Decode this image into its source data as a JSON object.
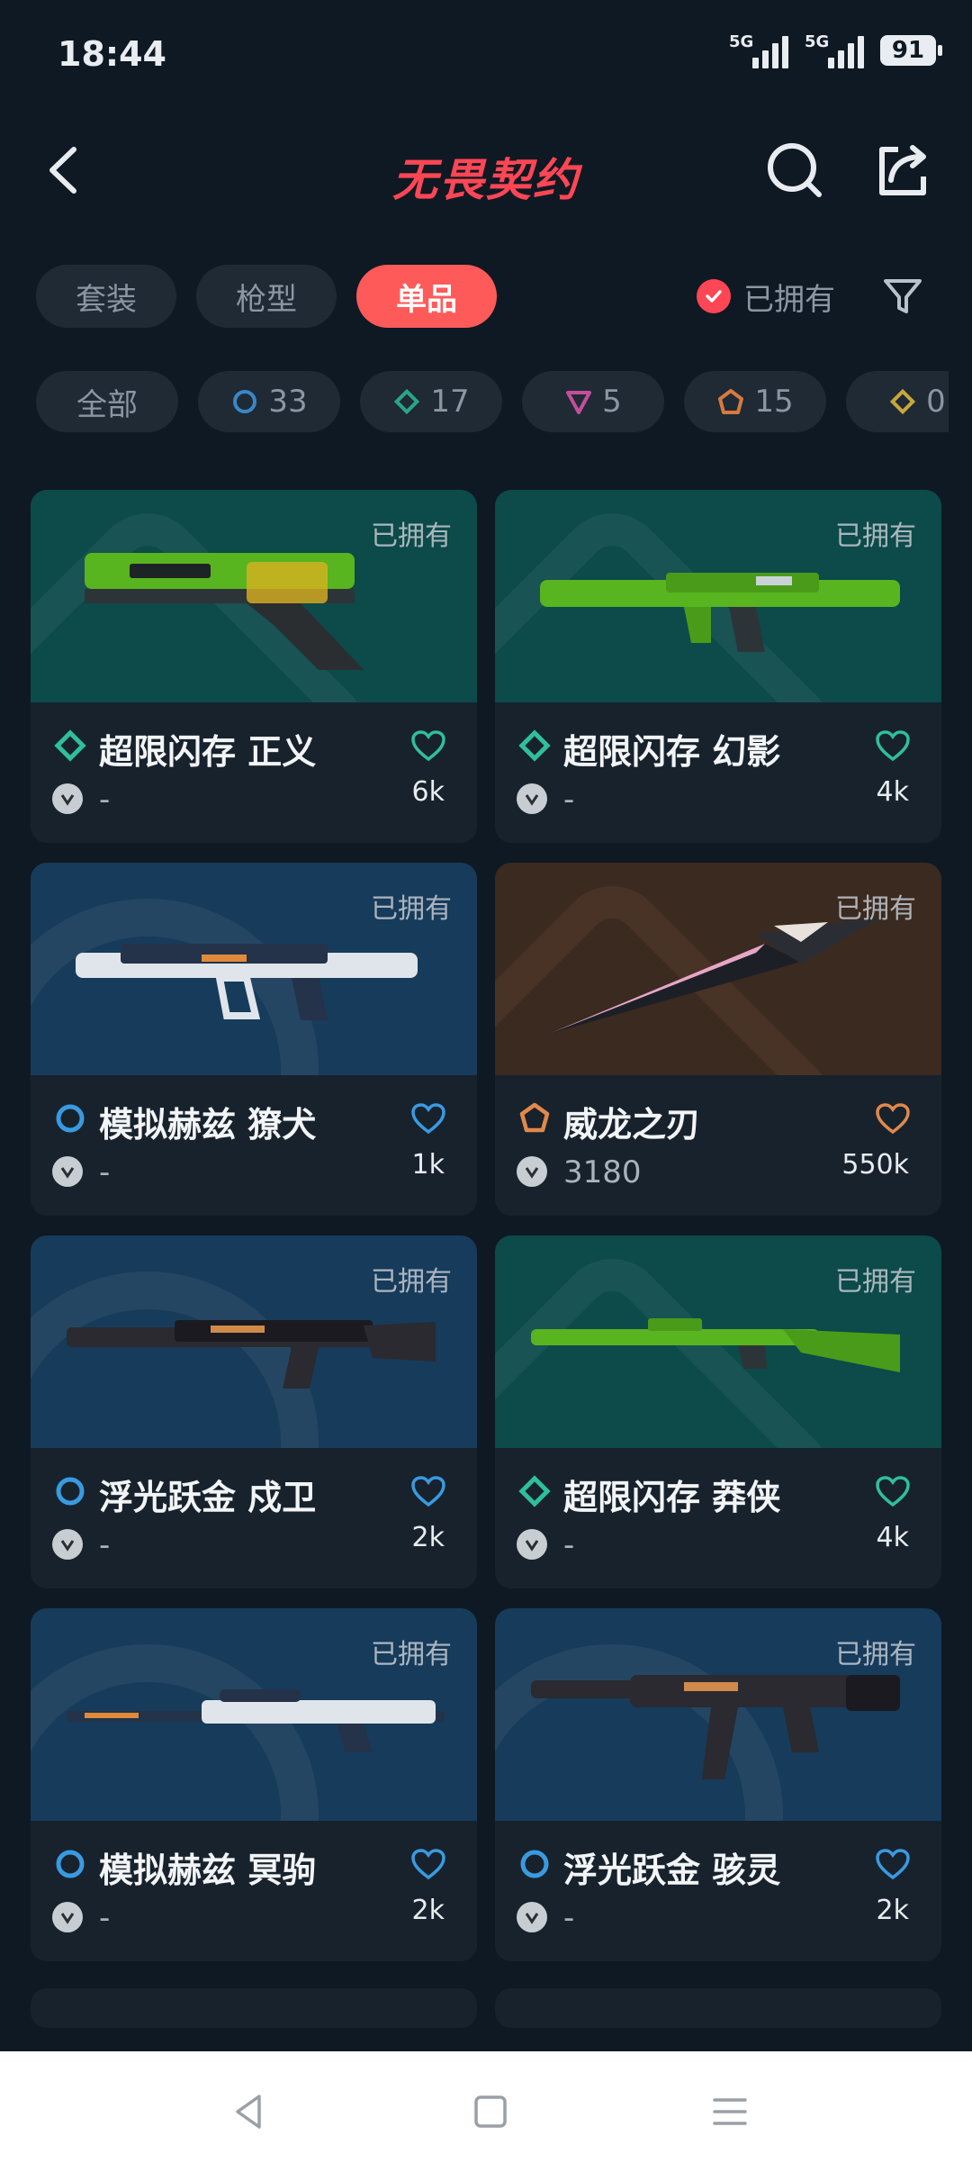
{
  "status_bar": {
    "time": "18:44",
    "signal1_label": "5G",
    "signal2_label": "5G",
    "battery": "91"
  },
  "header": {
    "title": "无畏契约"
  },
  "filters": {
    "tabs": [
      {
        "label": "套装"
      },
      {
        "label": "枪型"
      },
      {
        "label": "单品"
      }
    ],
    "owned_label": "已拥有"
  },
  "rarity": [
    {
      "label": "全部"
    },
    {
      "count": "33",
      "color": "#3a86c8",
      "shape": "ring-icon"
    },
    {
      "count": "17",
      "color": "#2aa58a",
      "shape": "diamond-icon"
    },
    {
      "count": "5",
      "color": "#c44e9a",
      "shape": "triangle-icon"
    },
    {
      "count": "15",
      "color": "#d67a3f",
      "shape": "pentagon-icon"
    },
    {
      "count": "0",
      "color": "#c9a73a",
      "shape": "diamond-icon"
    }
  ],
  "items": [
    {
      "name": "超限闪存 正义",
      "tag": "已拥有",
      "price": "-",
      "likes": "6k",
      "tier_color": "#2fbf9b",
      "bg": "#0d4a4a",
      "weapon_color": "#58b41f"
    },
    {
      "name": "超限闪存 幻影",
      "tag": "已拥有",
      "price": "-",
      "likes": "4k",
      "tier_color": "#2fbf9b",
      "bg": "#0d4a4a",
      "weapon_color": "#58b41f"
    },
    {
      "name": "模拟赫兹 獠犬",
      "tag": "已拥有",
      "price": "-",
      "likes": "1k",
      "tier_color": "#3a9ae0",
      "bg": "#173b5a",
      "weapon_color": "#dfe5ea"
    },
    {
      "name": "威龙之刃",
      "tag": "已拥有",
      "price": "3180",
      "likes": "550k",
      "tier_color": "#e0894a",
      "bg": "#3a2a20",
      "weapon_color": "#2b2d35"
    },
    {
      "name": "浮光跃金 戍卫",
      "tag": "已拥有",
      "price": "-",
      "likes": "2k",
      "tier_color": "#3a9ae0",
      "bg": "#173b5a",
      "weapon_color": "#2a2a30"
    },
    {
      "name": "超限闪存 莽侠",
      "tag": "已拥有",
      "price": "-",
      "likes": "4k",
      "tier_color": "#2fbf9b",
      "bg": "#0d4a4a",
      "weapon_color": "#58b41f"
    },
    {
      "name": "模拟赫兹 冥驹",
      "tag": "已拥有",
      "price": "-",
      "likes": "2k",
      "tier_color": "#3a9ae0",
      "bg": "#173b5a",
      "weapon_color": "#dfe5ea"
    },
    {
      "name": "浮光跃金 骇灵",
      "tag": "已拥有",
      "price": "-",
      "likes": "2k",
      "tier_color": "#3a9ae0",
      "bg": "#173b5a",
      "weapon_color": "#2a2a30"
    }
  ]
}
